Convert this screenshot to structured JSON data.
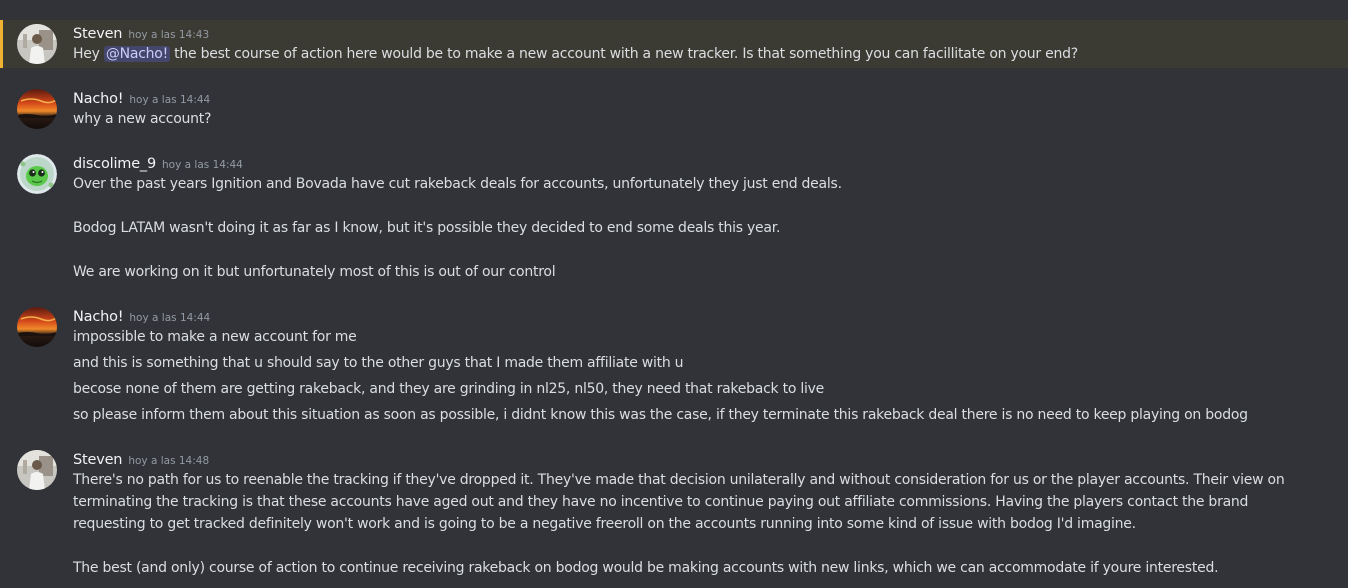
{
  "messages": [
    {
      "username": "Steven",
      "timestamp": "hoy a las 14:43",
      "text_before": "Hey ",
      "mention": "@Nacho!",
      "text_after": " the best course of action here would be to make a new account with a new tracker. Is that something you can facillitate on your end?"
    },
    {
      "username": "Nacho!",
      "timestamp": "hoy a las 14:44",
      "lines": [
        "why a new account?"
      ]
    },
    {
      "username": "discolime_9",
      "timestamp": "hoy a las 14:44",
      "lines": [
        "Over the past years Ignition and Bovada have cut rakeback deals for accounts, unfortunately they just end deals.",
        "Bodog LATAM wasn't doing it as far as I know, but it's possible they decided to end some deals this year.",
        "We are working on it but unfortunately most of this is out of our control"
      ]
    },
    {
      "username": "Nacho!",
      "timestamp": "hoy a las 14:44",
      "lines": [
        "impossible to make a new account for me",
        "and this is something that u should say to the other guys that I made them affiliate with u",
        "becose none of them are getting rakeback, and they are grinding in nl25, nl50, they need that rakeback to live",
        "so please inform them about this situation as soon as possible, i didnt know this was the case, if they terminate this rakeback deal there is no need to keep playing on bodog"
      ]
    },
    {
      "username": "Steven",
      "timestamp": "hoy a las 14:48",
      "lines": [
        "There's no path for us to reenable the tracking if they've dropped it. They've made that decision unilaterally and without consideration for us or the player accounts. Their view on terminating the tracking is that these accounts have aged out and they have no incentive to continue paying out affiliate commissions. Having the players contact the brand requesting to get tracked definitely won't work and is going to be a negative freeroll on the accounts running into some kind of issue with bodog I'd imagine.",
        "The best (and only) course of action to continue receiving rakeback on bodog would be making accounts with new links, which we can accommodate if youre interested."
      ]
    }
  ]
}
